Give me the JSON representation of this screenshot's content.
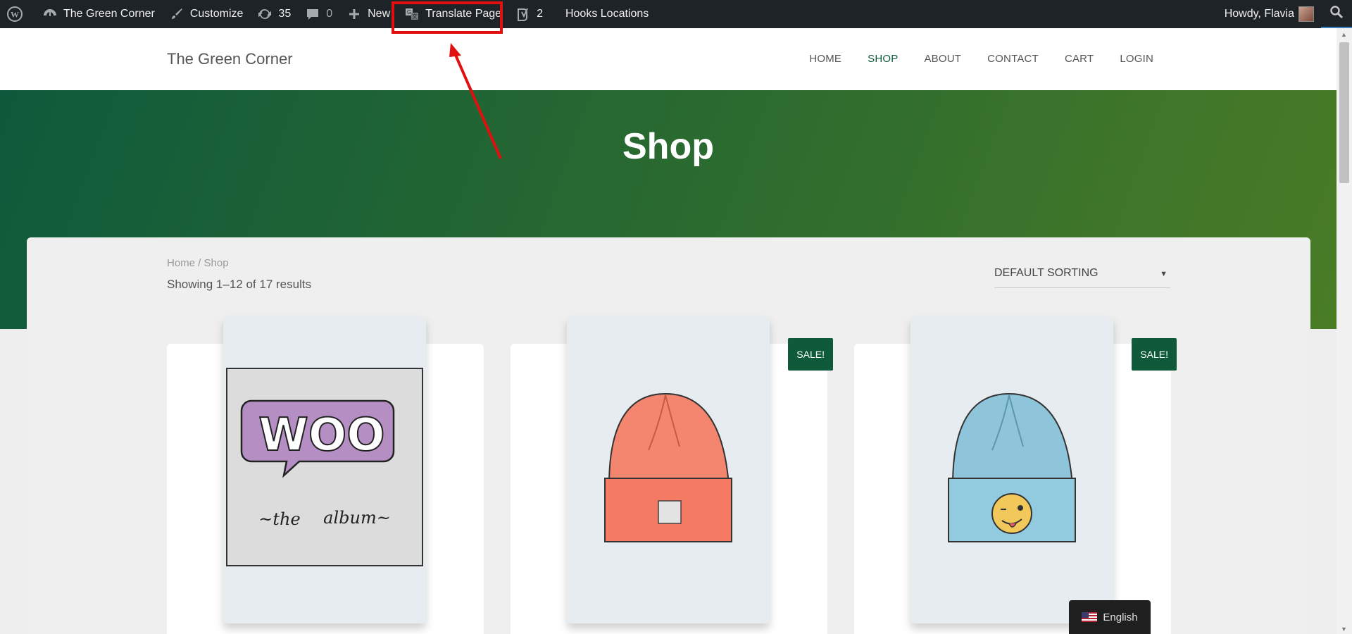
{
  "admin_bar": {
    "site_name": "The Green Corner",
    "customize": "Customize",
    "updates_count": "35",
    "comments_count": "0",
    "new_label": "New",
    "translate_page": "Translate Page",
    "yoast_count": "2",
    "hooks_locations": "Hooks Locations",
    "greeting": "Howdy, Flavia"
  },
  "header": {
    "brand": "The Green Corner",
    "nav": {
      "home": "HOME",
      "shop": "SHOP",
      "about": "ABOUT",
      "contact": "CONTACT",
      "cart": "CART",
      "login": "LOGIN"
    },
    "active_nav": "SHOP"
  },
  "hero": {
    "title": "Shop"
  },
  "shop": {
    "breadcrumb_home": "Home",
    "breadcrumb_separator": " / ",
    "breadcrumb_current": "Shop",
    "results": "Showing 1–12 of 17 results",
    "sorting": "DEFAULT SORTING"
  },
  "products": [
    {
      "image": "woo-album-icon",
      "sale": ""
    },
    {
      "image": "orange-beanie-icon",
      "sale": "SALE!"
    },
    {
      "image": "blue-beanie-icon",
      "sale": "SALE!"
    }
  ],
  "language": {
    "label": "English"
  },
  "colors": {
    "admin_bar": "#1d2327",
    "accent_green": "#0e5a3a",
    "highlight_red": "#e01010"
  }
}
